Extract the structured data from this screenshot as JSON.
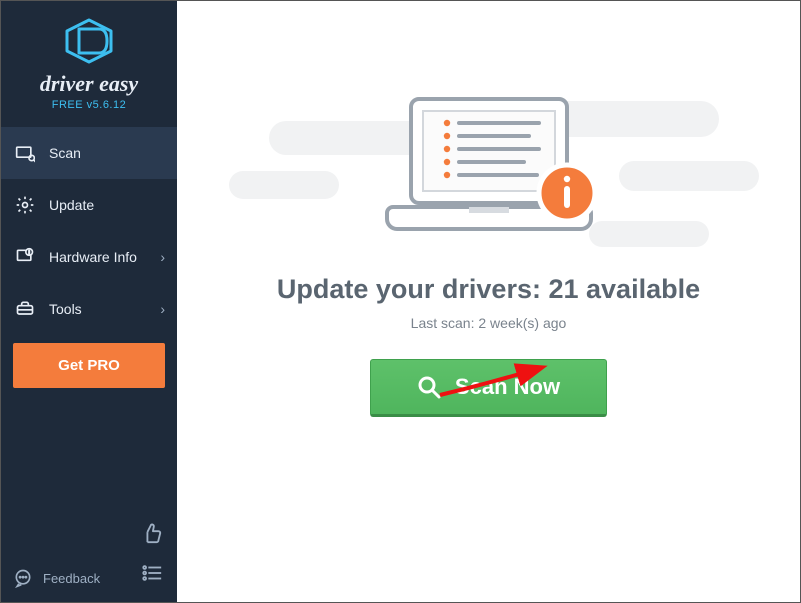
{
  "app": {
    "name": "driver easy",
    "version_label": "FREE v5.6.12"
  },
  "sidebar": {
    "items": [
      {
        "label": "Scan",
        "icon": "scan-icon"
      },
      {
        "label": "Update",
        "icon": "gear-icon"
      },
      {
        "label": "Hardware Info",
        "icon": "hardware-icon"
      },
      {
        "label": "Tools",
        "icon": "tools-icon"
      }
    ],
    "getpro_label": "Get PRO",
    "feedback_label": "Feedback"
  },
  "main": {
    "headline_prefix": "Update your drivers: ",
    "available_count": 21,
    "headline_suffix": " available",
    "last_scan_label": "Last scan: 2 week(s) ago",
    "scan_button_label": "Scan Now"
  }
}
